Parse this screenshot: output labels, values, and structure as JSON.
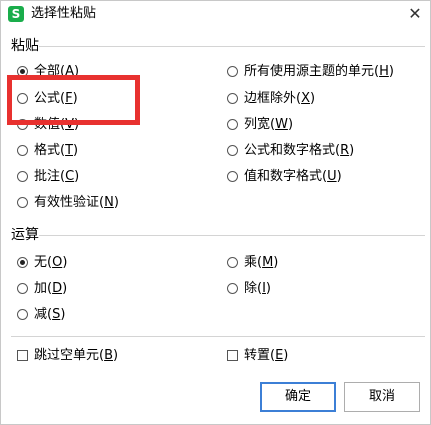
{
  "window": {
    "title": "选择性粘贴",
    "app_icon_letter": "S",
    "close_glyph": "✕",
    "accent_color": "#1aad4b"
  },
  "paste": {
    "section_label": "粘贴",
    "options": [
      {
        "text": "全部(",
        "key": "A",
        "suffix": ")",
        "checked": true
      },
      {
        "text": "公式(",
        "key": "F",
        "suffix": ")",
        "checked": false
      },
      {
        "text": "数值(",
        "key": "V",
        "suffix": ")",
        "checked": false
      },
      {
        "text": "格式(",
        "key": "T",
        "suffix": ")",
        "checked": false
      },
      {
        "text": "批注(",
        "key": "C",
        "suffix": ")",
        "checked": false
      },
      {
        "text": "有效性验证(",
        "key": "N",
        "suffix": ")",
        "checked": false
      },
      {
        "text": "所有使用源主题的单元(",
        "key": "H",
        "suffix": ")",
        "checked": false
      },
      {
        "text": "边框除外(",
        "key": "X",
        "suffix": ")",
        "checked": false
      },
      {
        "text": "列宽(",
        "key": "W",
        "suffix": ")",
        "checked": false
      },
      {
        "text": "公式和数字格式(",
        "key": "R",
        "suffix": ")",
        "checked": false
      },
      {
        "text": "值和数字格式(",
        "key": "U",
        "suffix": ")",
        "checked": false
      }
    ]
  },
  "operation": {
    "section_label": "运算",
    "options": [
      {
        "text": "无(",
        "key": "O",
        "suffix": ")",
        "checked": true
      },
      {
        "text": "加(",
        "key": "D",
        "suffix": ")",
        "checked": false
      },
      {
        "text": "减(",
        "key": "S",
        "suffix": ")",
        "checked": false
      },
      {
        "text": "乘(",
        "key": "M",
        "suffix": ")",
        "checked": false
      },
      {
        "text": "除(",
        "key": "I",
        "suffix": ")",
        "checked": false
      }
    ]
  },
  "extras": {
    "skip_blanks": {
      "text": "跳过空单元(",
      "key": "B",
      "suffix": ")",
      "checked": false
    },
    "transpose": {
      "text": "转置(",
      "key": "E",
      "suffix": ")",
      "checked": false
    }
  },
  "buttons": {
    "ok": "确定",
    "cancel": "取消"
  },
  "highlight": {
    "color": "#e8312f",
    "target": "公式(F)"
  }
}
